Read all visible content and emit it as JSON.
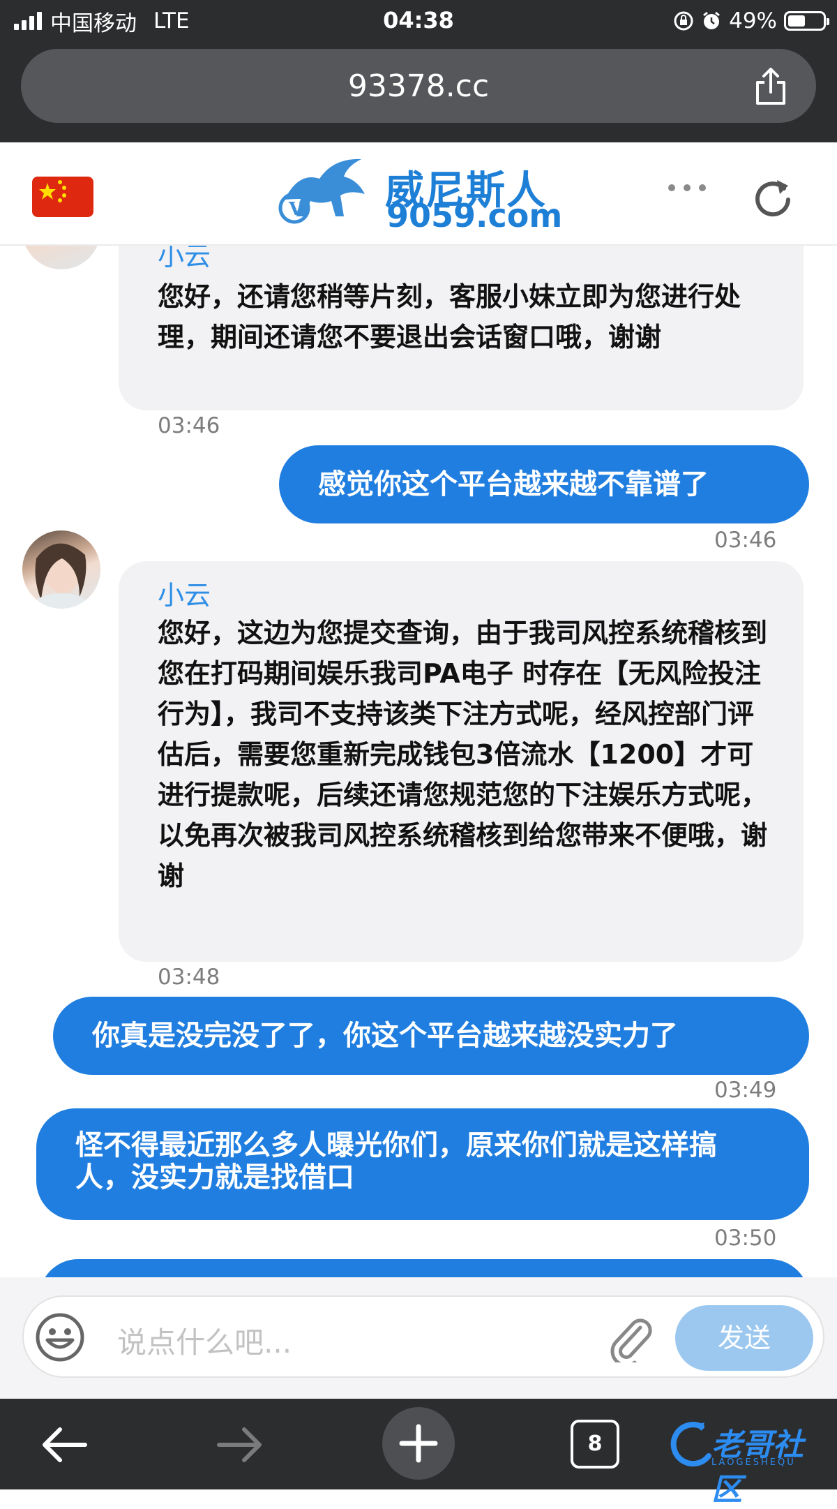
{
  "status_bar": {
    "carrier": "中国移动",
    "network": "LTE",
    "time": "04:38",
    "battery": "49%",
    "battery_level": 0.49
  },
  "browser": {
    "url": "93378.cc",
    "tab_count": "8"
  },
  "site_header": {
    "logo_text": "威尼斯人",
    "logo_url": "9059.com"
  },
  "chat": {
    "messages": [
      {
        "direction": "in",
        "sender": "小云",
        "text": "您好，还请您稍等片刻，客服小妹立即为您进行处理，期间还请您不要退出会话窗口哦，谢谢",
        "time": "03:46"
      },
      {
        "direction": "out",
        "text": "感觉你这个平台越来越不靠谱了",
        "time": "03:46"
      },
      {
        "direction": "in",
        "sender": "小云",
        "text": "您好，这边为您提交查询，由于我司风控系统稽核到您在打码期间娱乐我司PA电子 时存在【无风险投注行为】，我司不支持该类下注方式呢，经风控部门评估后，需要您重新完成钱包3倍流水【1200】才可进行提款呢，后续还请您规范您的下注娱乐方式呢，以免再次被我司风控系统稽核到给您带来不便哦，谢谢",
        "time": "03:48"
      },
      {
        "direction": "out",
        "text": "你真是没完没了了，你这个平台越来越没实力了",
        "time": "03:49"
      },
      {
        "direction": "out",
        "text": "怪不得最近那么多人曝光你们，原来你们就是这样搞人，没实力就是找借口",
        "time": "03:50"
      }
    ]
  },
  "input": {
    "placeholder": "说点什么吧...",
    "send_label": "发送"
  },
  "watermark": {
    "text": "老哥社区",
    "sub": "LAOGESHEQU"
  },
  "colors": {
    "bubble_out": "#1f7ee0",
    "bubble_in": "#f2f2f4",
    "sender_name": "#2e8ee6",
    "send_button": "#9cc8f0",
    "browser_chrome": "#2c2d2f"
  }
}
